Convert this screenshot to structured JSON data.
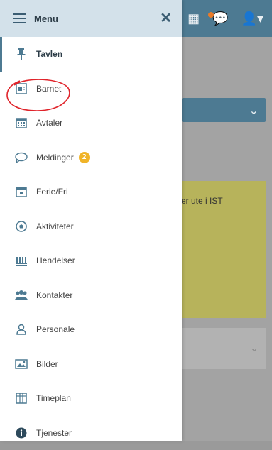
{
  "menu": {
    "title": "Menu",
    "items": [
      {
        "label": "Tavlen",
        "icon": "pin-icon",
        "active": true
      },
      {
        "label": "Barnet",
        "icon": "child-card-icon"
      },
      {
        "label": "Avtaler",
        "icon": "calendar-icon"
      },
      {
        "label": "Meldinger",
        "icon": "speech-bubble-icon",
        "badge": "2"
      },
      {
        "label": "Ferie/Fri",
        "icon": "calendar-check-icon"
      },
      {
        "label": "Aktiviteter",
        "icon": "soccer-ball-icon"
      },
      {
        "label": "Hendelser",
        "icon": "events-icon"
      },
      {
        "label": "Kontakter",
        "icon": "contacts-icon"
      },
      {
        "label": "Personale",
        "icon": "person-icon"
      },
      {
        "label": "Bilder",
        "icon": "image-icon"
      },
      {
        "label": "Timeplan",
        "icon": "timetable-icon"
      },
      {
        "label": "Tjenester",
        "icon": "info-icon"
      }
    ]
  },
  "background": {
    "notice_text": "er ute i IST"
  },
  "colors": {
    "accent": "#4d7a92",
    "header_bg": "#d3e1ea",
    "badge": "#f0b429",
    "annotation": "#e0232a"
  }
}
